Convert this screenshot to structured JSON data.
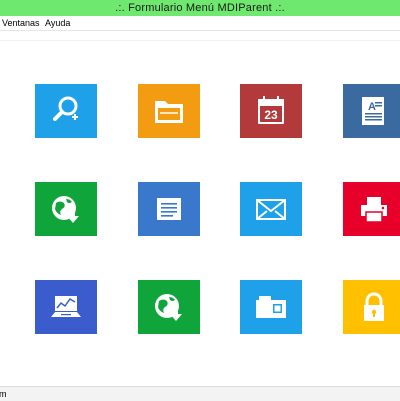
{
  "window": {
    "title": ".:. Formulario Menú MDIParent .:."
  },
  "menu": {
    "ventanas": "Ventanas",
    "ayuda": "Ayuda"
  },
  "status": {
    "text": "om"
  },
  "tiles": [
    {
      "icon": "search-icon",
      "color": "#1ea1e8"
    },
    {
      "icon": "folder-icon",
      "color": "#f39c12"
    },
    {
      "icon": "calendar-icon",
      "color": "#b23a3a"
    },
    {
      "icon": "document-icon",
      "color": "#3a6aa0"
    },
    {
      "icon": "globe-download-icon",
      "color": "#10a53a"
    },
    {
      "icon": "notes-icon",
      "color": "#3a78cc"
    },
    {
      "icon": "mail-icon",
      "color": "#1ea1e8"
    },
    {
      "icon": "printer-icon",
      "color": "#e6002a"
    },
    {
      "icon": "laptop-chart-icon",
      "color": "#3a5ccc"
    },
    {
      "icon": "globe-download-icon",
      "color": "#10a53a"
    },
    {
      "icon": "card-icon",
      "color": "#1ea1e8"
    },
    {
      "icon": "lock-icon",
      "color": "#ffc000"
    }
  ],
  "calendar": {
    "day": "23"
  }
}
